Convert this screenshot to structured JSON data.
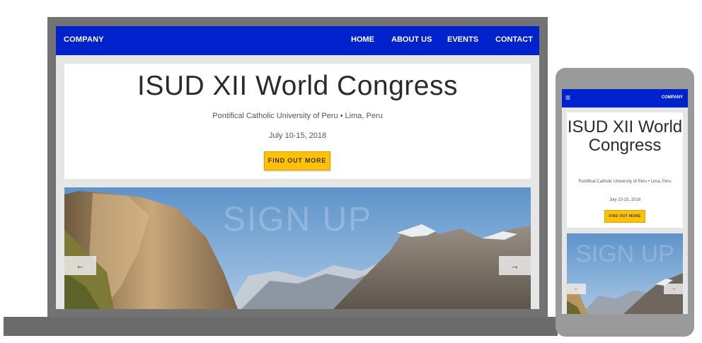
{
  "laptop": {
    "navbar": {
      "brand": "COMPANY",
      "links": [
        "HOME",
        "ABOUT US",
        "EVENTS",
        "CONTACT"
      ]
    },
    "hero": {
      "title": "ISUD XII World Congress",
      "subtitle": "Pontifical Catholic University of Peru • Lima, Peru",
      "date": "July 10-15, 2018",
      "cta": "FIND OUT MORE"
    },
    "carousel": {
      "title": "SIGN UP",
      "prev_icon": "arrow-left-icon",
      "next_icon": "arrow-right-icon",
      "prev_glyph": "←",
      "next_glyph": "→"
    }
  },
  "phone": {
    "navbar": {
      "menu_icon": "hamburger-icon",
      "menu_glyph": "≡",
      "brand": "COMPANY"
    },
    "hero": {
      "title": "ISUD XII World Congress",
      "subtitle": "Pontifical Catholic University of Peru • Lima, Peru",
      "date": "July 10-15, 2018",
      "cta": "FIND OUT MORE"
    },
    "carousel": {
      "title": "SIGN UP",
      "prev_glyph": "←",
      "next_glyph": "→"
    }
  },
  "colors": {
    "navbar": "#0022cc",
    "cta": "#ffc107",
    "device_frame": "#737373"
  }
}
